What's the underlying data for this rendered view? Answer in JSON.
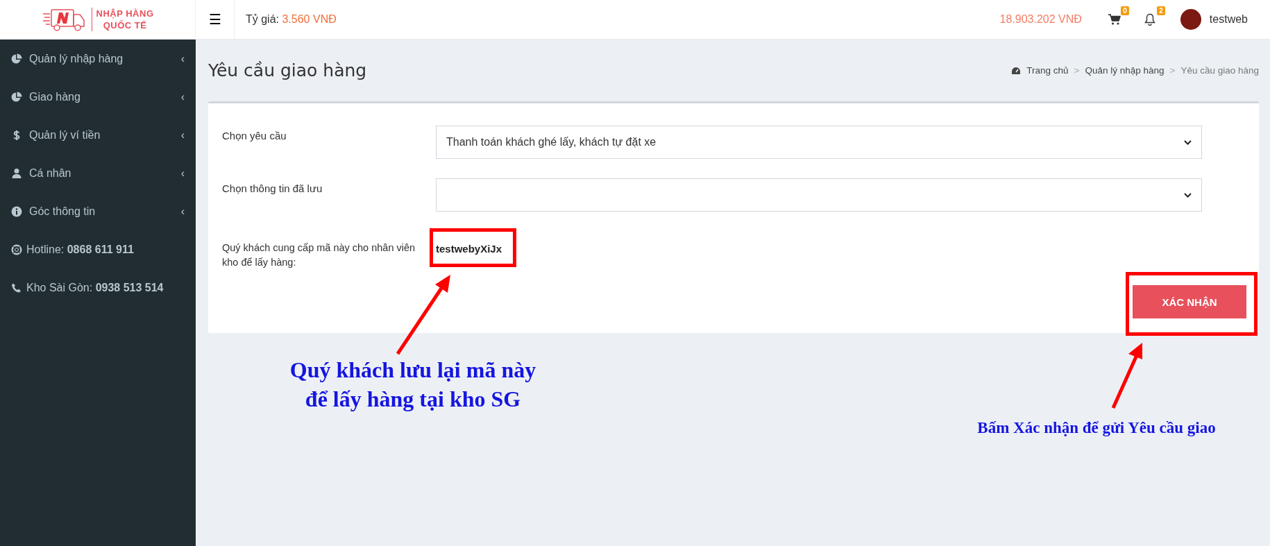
{
  "header": {
    "logo_line1": "NHẬP HÀNG",
    "logo_line2": "QUỐC TẾ",
    "menu_icon": "☰",
    "rate_label": "Tỷ giá:",
    "rate_value": "3.560 VNĐ",
    "balance": "18.903.202 VNĐ",
    "cart_count": "0",
    "notification_count": "2",
    "username": "testweb"
  },
  "sidebar": {
    "items": [
      {
        "kind": "menu",
        "label": "Quản lý nhập hàng",
        "arrow": "‹"
      },
      {
        "kind": "menu",
        "label": "Giao hàng",
        "arrow": "‹"
      },
      {
        "kind": "menu",
        "label": "Quản lý ví tiền",
        "arrow": "‹"
      },
      {
        "kind": "menu",
        "label": "Cá nhân",
        "arrow": "‹"
      },
      {
        "kind": "menu",
        "label": "Góc thông tin",
        "arrow": "‹"
      },
      {
        "kind": "contact",
        "label": "Hotline:",
        "value": "0868 611 911"
      },
      {
        "kind": "contact",
        "label": "Kho Sài Gòn:",
        "value": "0938 513 514"
      }
    ]
  },
  "page": {
    "title": "Yêu cầu giao hàng",
    "breadcrumb": [
      "Trang chủ",
      "Quản lý nhập hàng",
      "Yêu cầu giao hàng"
    ],
    "breadcrumb_separator": ">"
  },
  "form": {
    "fields": [
      {
        "label": "Chọn yêu cầu",
        "value": "Thanh toán khách ghé lấy, khách tự đặt xe"
      },
      {
        "label": "Chọn thông tin đã lưu"
      }
    ],
    "code_label": "Quý khách cung cấp mã này cho nhân viên kho để lấy hàng:",
    "code": "testwebyXiJx",
    "submit": "XÁC NHẬN"
  },
  "annotations": [
    {
      "text": "Quý khách lưu lại mã này\nđể lấy hàng tại kho SG",
      "kind": "large"
    },
    {
      "text": "Bấm Xác nhận để gửi Yêu cầu giao",
      "kind": "small"
    }
  ]
}
